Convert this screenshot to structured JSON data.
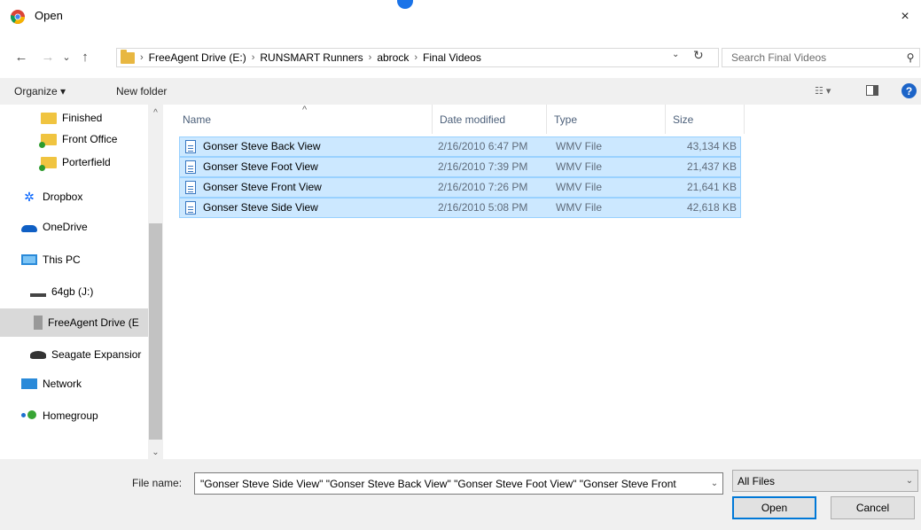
{
  "window": {
    "title": "Open",
    "close_glyph": "×"
  },
  "nav_buttons": {
    "back": "←",
    "forward": "→",
    "recent": "⌄",
    "up": "↑"
  },
  "address": {
    "crumbs": [
      "FreeAgent Drive (E:)",
      "RUNSMART Runners",
      "abrock",
      "Final Videos"
    ],
    "separator": "›",
    "dropdown_glyph": "⌄",
    "refresh_glyph": "↻"
  },
  "search": {
    "placeholder": "Search Final Videos",
    "icon_glyph": "⚲"
  },
  "toolbar": {
    "organize_label": "Organize ▾",
    "new_folder_label": "New folder",
    "view_glyph": "☷ ▾",
    "help_glyph": "?"
  },
  "nav_pane": {
    "items": [
      {
        "label": "Finished",
        "icon": "folder-icon"
      },
      {
        "label": "Front Office",
        "icon": "shared-folder-icon"
      },
      {
        "label": "Porterfield",
        "icon": "shared-folder-icon"
      },
      {
        "label": "Dropbox",
        "icon": "dropbox-icon"
      },
      {
        "label": "OneDrive",
        "icon": "onedrive-icon"
      },
      {
        "label": "This PC",
        "icon": "computer-icon"
      },
      {
        "label": "64gb (J:)",
        "icon": "usb-drive-icon"
      },
      {
        "label": "FreeAgent Drive (E",
        "icon": "external-drive-icon"
      },
      {
        "label": "Seagate Expansior",
        "icon": "seagate-drive-icon"
      },
      {
        "label": "Network",
        "icon": "network-icon"
      },
      {
        "label": "Homegroup",
        "icon": "homegroup-icon"
      }
    ],
    "selected_index": 7,
    "scroll_up": "^",
    "scroll_down": "⌄",
    "dropbox_glyph": "✲"
  },
  "file_list": {
    "columns": [
      "Name",
      "Date modified",
      "Type",
      "Size"
    ],
    "sort_glyph": "^",
    "rows": [
      {
        "name": "Gonser Steve Back View",
        "date": "2/16/2010 6:47 PM",
        "type": "WMV File",
        "size": "43,134 KB"
      },
      {
        "name": "Gonser Steve Foot View",
        "date": "2/16/2010 7:39 PM",
        "type": "WMV File",
        "size": "21,437 KB"
      },
      {
        "name": "Gonser Steve Front View",
        "date": "2/16/2010 7:26 PM",
        "type": "WMV File",
        "size": "21,641 KB"
      },
      {
        "name": "Gonser Steve Side View",
        "date": "2/16/2010 5:08 PM",
        "type": "WMV File",
        "size": "42,618 KB"
      }
    ]
  },
  "bottom": {
    "file_name_label": "File name:",
    "file_name_value": "\"Gonser Steve Side View\" \"Gonser Steve Back View\" \"Gonser Steve Foot View\" \"Gonser Steve Front",
    "dropdown_glyph": "⌄",
    "filter_value": "All Files",
    "open_label": "Open",
    "cancel_label": "Cancel"
  },
  "colors": {
    "selection_fill": "#cce8ff",
    "selection_border": "#99d1ff",
    "accent": "#0078d7"
  }
}
